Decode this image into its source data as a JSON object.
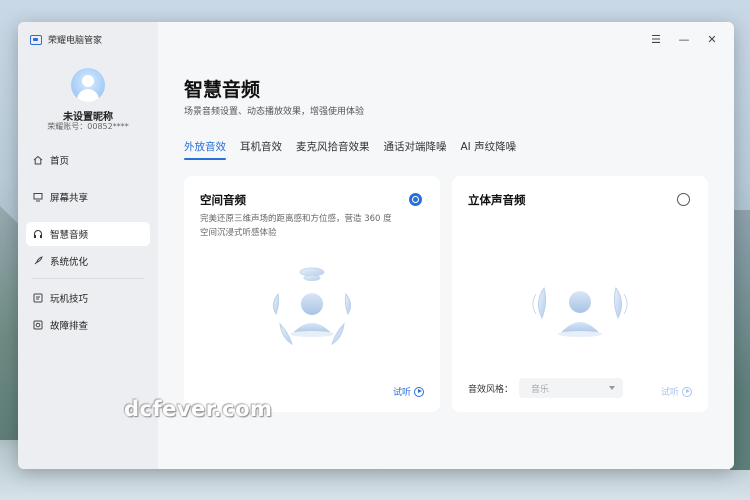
{
  "app": {
    "title": "荣耀电脑管家"
  },
  "user": {
    "name": "未设置昵称",
    "account": "荣耀账号：00852****"
  },
  "sidebar": {
    "items": [
      {
        "label": "首页",
        "icon": "home-icon"
      },
      {
        "label": "屏幕共享",
        "icon": "screen-share-icon"
      },
      {
        "label": "智慧音频",
        "icon": "headphones-icon",
        "active": true
      },
      {
        "label": "系统优化",
        "icon": "rocket-icon"
      },
      {
        "label": "玩机技巧",
        "icon": "tips-icon"
      },
      {
        "label": "故障排查",
        "icon": "troubleshoot-icon"
      }
    ]
  },
  "window_controls": {
    "menu": "☰",
    "minimize": "—",
    "close": "✕"
  },
  "page": {
    "title": "智慧音频",
    "subtitle": "场景音频设置、动态播放效果，增强使用体验"
  },
  "tabs": [
    {
      "label": "外放音效",
      "active": true
    },
    {
      "label": "耳机音效"
    },
    {
      "label": "麦克风拾音效果"
    },
    {
      "label": "通话对端降噪"
    },
    {
      "label": "AI 声纹降噪"
    }
  ],
  "cards": {
    "spatial": {
      "title": "空间音频",
      "description": "完美还原三维声场的距离感和方位感，营造 360 度空间沉浸式听感体验",
      "selected": true,
      "listen": "试听"
    },
    "stereo": {
      "title": "立体声音频",
      "selected": false,
      "effect_label": "音效风格：",
      "effect_value": "音乐",
      "listen": "试听"
    }
  },
  "watermark": "dcfever.com",
  "colors": {
    "accent": "#2a6fd8",
    "listen_disabled": "#a9c4ec"
  }
}
